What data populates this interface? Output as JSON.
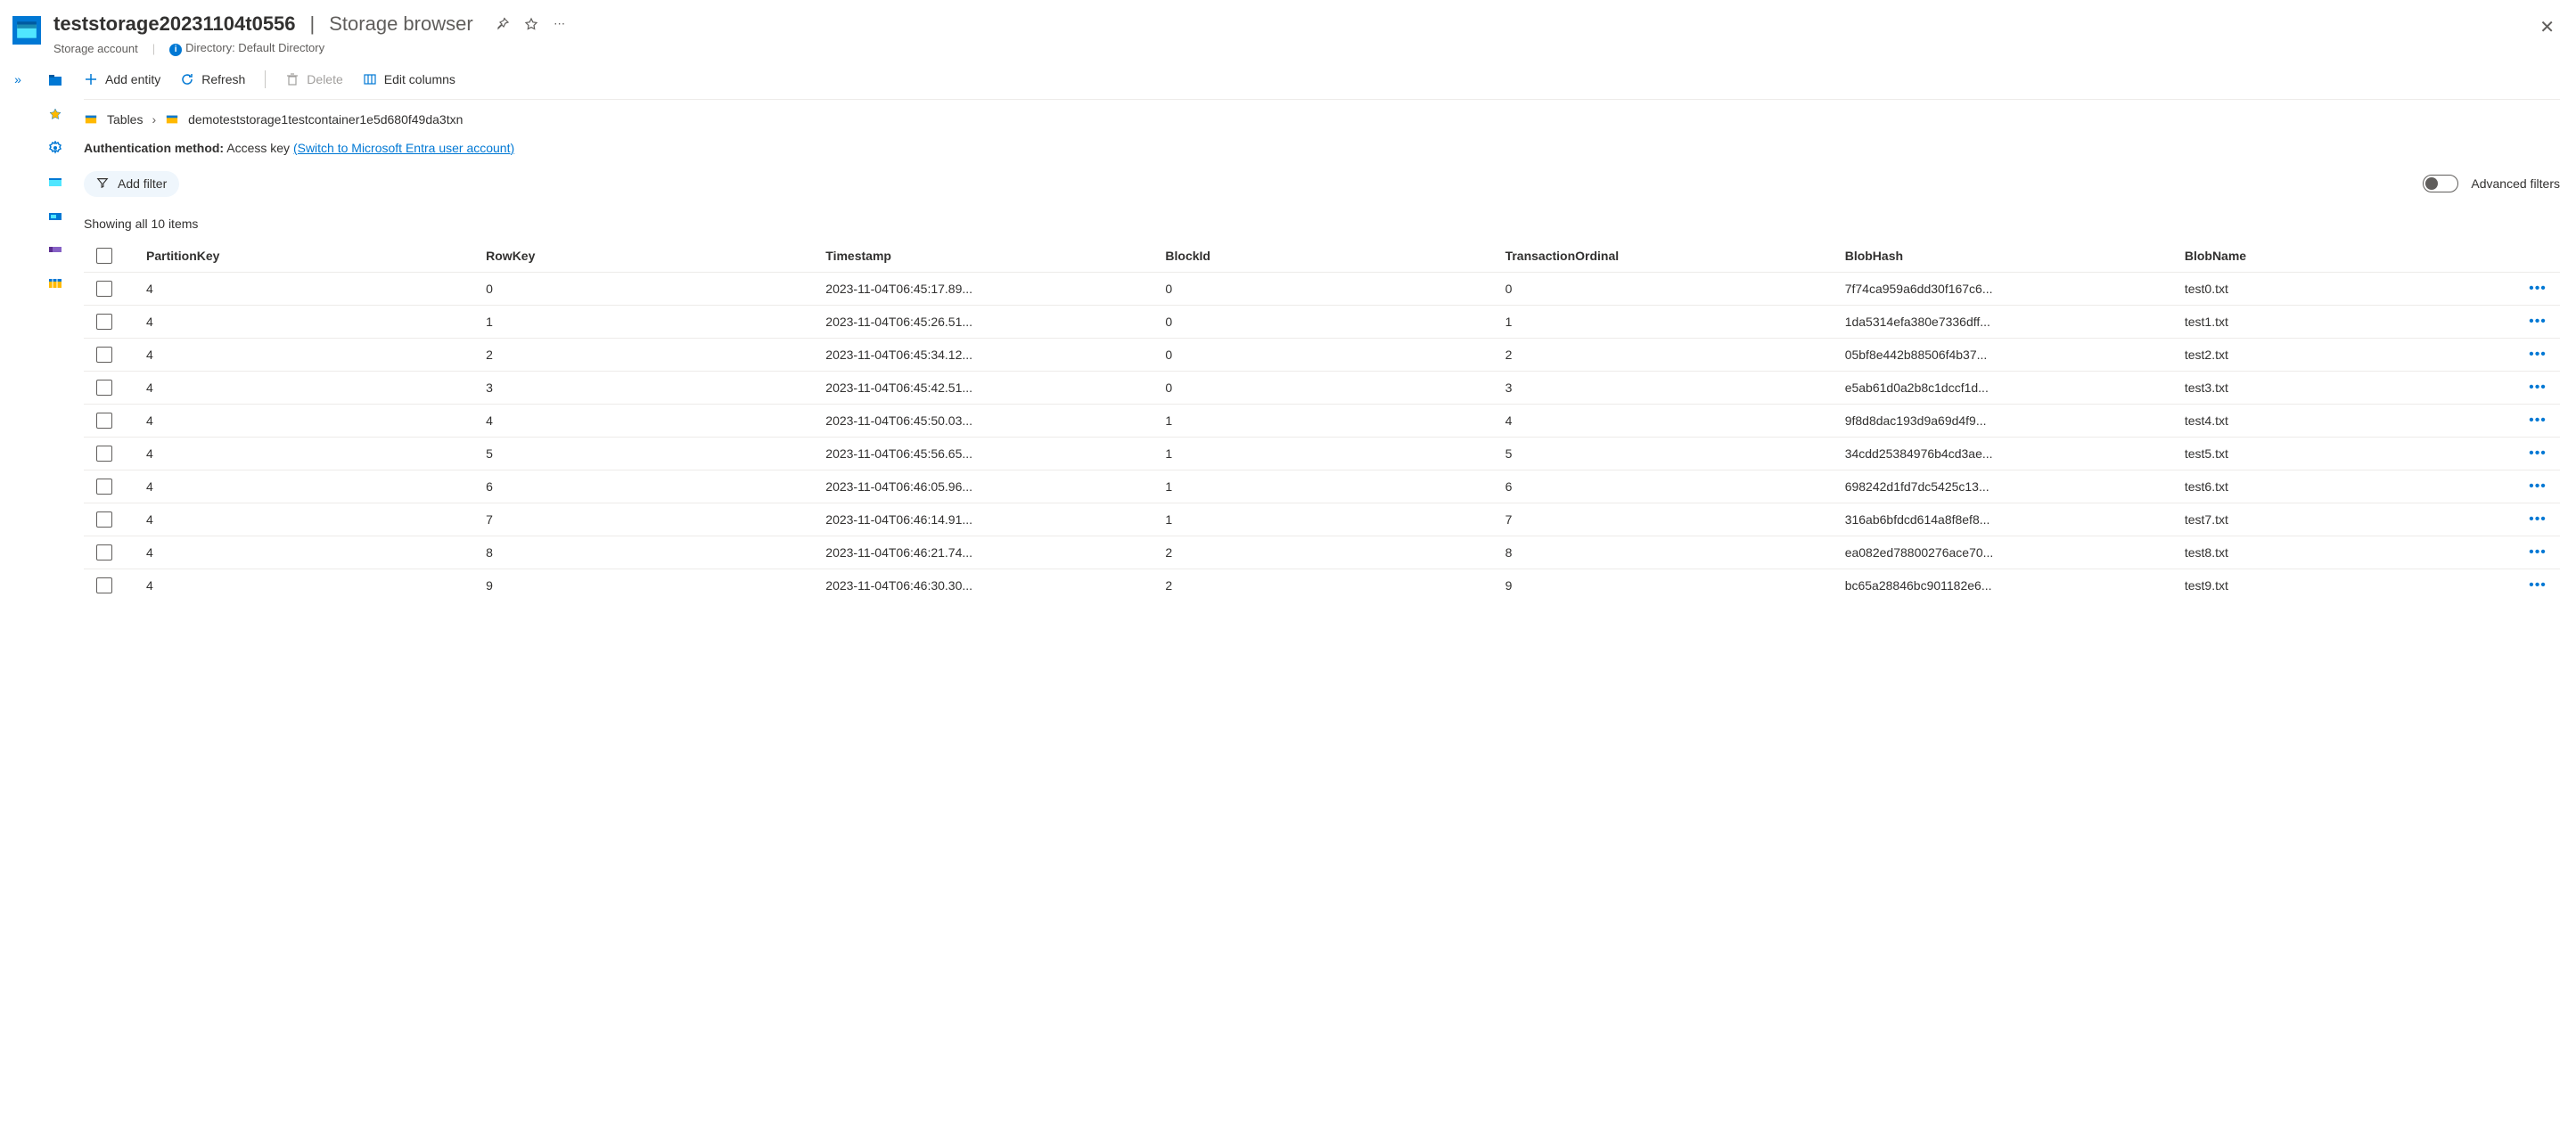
{
  "header": {
    "title": "teststorage20231104t0556",
    "section": "Storage browser",
    "resource_type": "Storage account",
    "directory_label": "Directory: Default Directory"
  },
  "toolbar": {
    "add_entity": "Add entity",
    "refresh": "Refresh",
    "delete": "Delete",
    "edit_columns": "Edit columns"
  },
  "breadcrumb": {
    "root": "Tables",
    "current": "demoteststorage1testcontainer1e5d680f49da3txn"
  },
  "auth": {
    "label": "Authentication method:",
    "method": "Access key",
    "switch_link": "(Switch to Microsoft Entra user account)"
  },
  "filters": {
    "add_filter": "Add filter",
    "advanced_label": "Advanced filters"
  },
  "count_text": "Showing all 10 items",
  "columns": [
    "PartitionKey",
    "RowKey",
    "Timestamp",
    "BlockId",
    "TransactionOrdinal",
    "BlobHash",
    "BlobName"
  ],
  "rows": [
    {
      "pk": "4",
      "rk": "0",
      "ts": "2023-11-04T06:45:17.89...",
      "bid": "0",
      "to": "0",
      "bh": "7f74ca959a6dd30f167c6...",
      "bn": "test0.txt"
    },
    {
      "pk": "4",
      "rk": "1",
      "ts": "2023-11-04T06:45:26.51...",
      "bid": "0",
      "to": "1",
      "bh": "1da5314efa380e7336dff...",
      "bn": "test1.txt"
    },
    {
      "pk": "4",
      "rk": "2",
      "ts": "2023-11-04T06:45:34.12...",
      "bid": "0",
      "to": "2",
      "bh": "05bf8e442b88506f4b37...",
      "bn": "test2.txt"
    },
    {
      "pk": "4",
      "rk": "3",
      "ts": "2023-11-04T06:45:42.51...",
      "bid": "0",
      "to": "3",
      "bh": "e5ab61d0a2b8c1dccf1d...",
      "bn": "test3.txt"
    },
    {
      "pk": "4",
      "rk": "4",
      "ts": "2023-11-04T06:45:50.03...",
      "bid": "1",
      "to": "4",
      "bh": "9f8d8dac193d9a69d4f9...",
      "bn": "test4.txt"
    },
    {
      "pk": "4",
      "rk": "5",
      "ts": "2023-11-04T06:45:56.65...",
      "bid": "1",
      "to": "5",
      "bh": "34cdd25384976b4cd3ae...",
      "bn": "test5.txt"
    },
    {
      "pk": "4",
      "rk": "6",
      "ts": "2023-11-04T06:46:05.96...",
      "bid": "1",
      "to": "6",
      "bh": "698242d1fd7dc5425c13...",
      "bn": "test6.txt"
    },
    {
      "pk": "4",
      "rk": "7",
      "ts": "2023-11-04T06:46:14.91...",
      "bid": "1",
      "to": "7",
      "bh": "316ab6bfdcd614a8f8ef8...",
      "bn": "test7.txt"
    },
    {
      "pk": "4",
      "rk": "8",
      "ts": "2023-11-04T06:46:21.74...",
      "bid": "2",
      "to": "8",
      "bh": "ea082ed78800276ace70...",
      "bn": "test8.txt"
    },
    {
      "pk": "4",
      "rk": "9",
      "ts": "2023-11-04T06:46:30.30...",
      "bid": "2",
      "to": "9",
      "bh": "bc65a28846bc901182e6...",
      "bn": "test9.txt"
    }
  ]
}
